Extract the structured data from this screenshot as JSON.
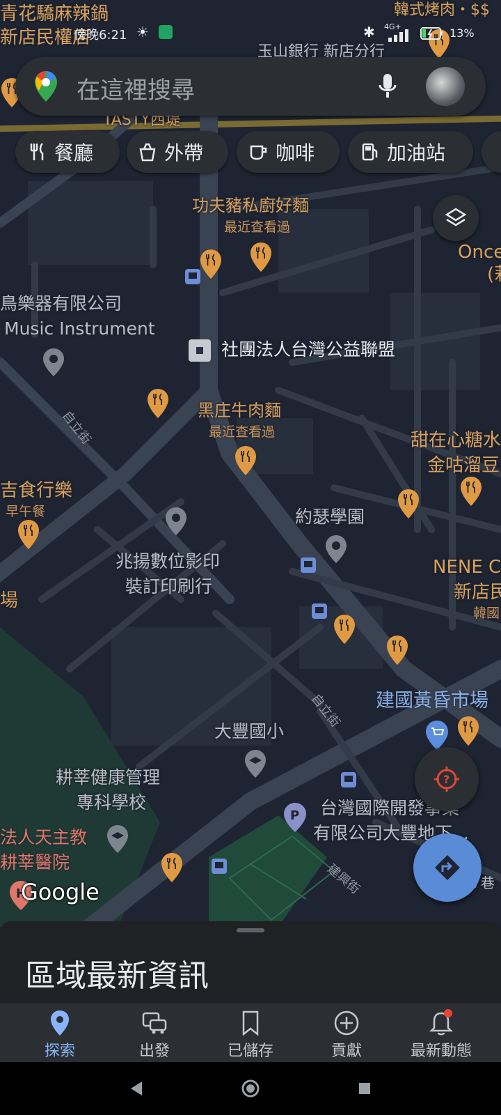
{
  "status_bar": {
    "time": "傍晚6:21",
    "network": "4G+",
    "battery_percent": "13%"
  },
  "search": {
    "placeholder": "在這裡搜尋"
  },
  "chips": [
    {
      "label": "餐廳",
      "icon": "fork-knife-icon"
    },
    {
      "label": "外帶",
      "icon": "takeout-icon"
    },
    {
      "label": "咖啡",
      "icon": "coffee-icon"
    },
    {
      "label": "加油站",
      "icon": "gas-station-icon"
    }
  ],
  "map": {
    "places": {
      "hua_jiao": "青花驕麻辣鍋",
      "xindian_minquan": "新店民權店",
      "korean_bbq": "韓式烤肉・$$",
      "yushan_bank": "玉山銀行 新店分行",
      "tasty": "TASTY西堤",
      "kungfu_noodle": "功夫豬私廚好麵",
      "recently_viewed_1": "最近查看過",
      "once": "Once",
      "once_sub": "(莉",
      "music_cn": "鳥樂器有限公司",
      "music_en": "Music Instrument",
      "public_welfare": "社團法人台灣公益聯盟",
      "beef_noodle": "黑庄牛肉麵",
      "recently_viewed_2": "最近查看過",
      "sweet_heart": "甜在心糖水",
      "jingu": "金咕溜豆",
      "breakfast": "吉食行樂",
      "breakfast_sub": "早午餐",
      "yuese": "約瑟學園",
      "zhaoyang_1": "兆揚數位影印",
      "zhaoyang_2": "裝訂印刷行",
      "nene": "NENE C",
      "nene_sub": "新店民",
      "nene_sub2": "韓國",
      "chang": "場",
      "jianguo_market": "建國黃昏市場",
      "dafeng_school": "大豐國小",
      "gengxin_1": "耕莘健康管理",
      "gengxin_2": "專科學校",
      "catholic": "法人天主教",
      "gengxin_hospital": "耕莘醫院",
      "taiwan_intl_1": "台灣國際開發事業",
      "taiwan_intl_2": "有限公司大豐地下...",
      "lane": "7巷"
    },
    "streets": {
      "ziliyjie_1": "自立街",
      "ziliyjie_2": "自立街",
      "jianxing": "建興街"
    },
    "attribution": "Google"
  },
  "sheet": {
    "title": "區域最新資訊"
  },
  "bottom_nav": [
    {
      "label": "探索",
      "icon": "explore-pin-icon",
      "active": true
    },
    {
      "label": "出發",
      "icon": "commute-icon",
      "active": false
    },
    {
      "label": "已儲存",
      "icon": "bookmark-icon",
      "active": false
    },
    {
      "label": "貢獻",
      "icon": "add-circle-icon",
      "active": false
    },
    {
      "label": "最新動態",
      "icon": "notifications-icon",
      "active": false
    }
  ],
  "colors": {
    "map_background": "#1e2431",
    "road": "#39414f",
    "food_pin": "#e09a43",
    "active_nav": "#8ab4f8",
    "directions_fab": "#5a8bd6",
    "location_fab_icon": "#e0463a"
  }
}
